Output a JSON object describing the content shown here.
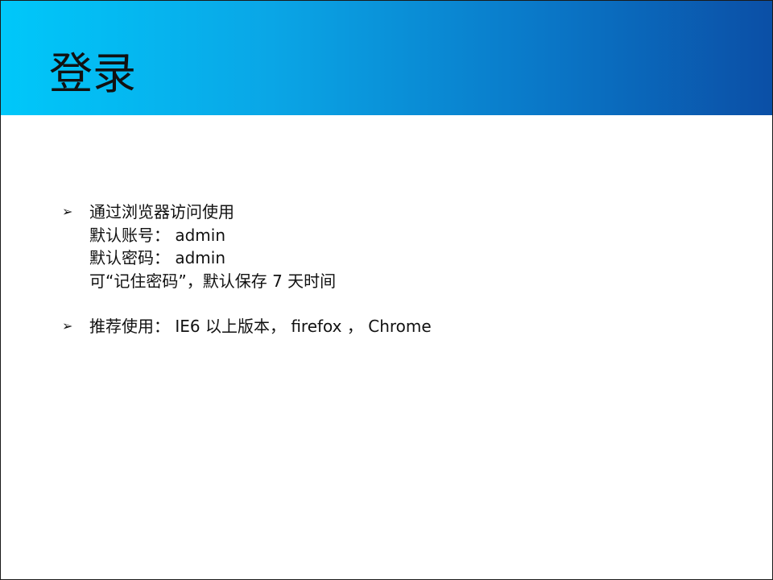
{
  "slide": {
    "title": "登录",
    "colors": {
      "band_left": "#00c8fa",
      "band_right": "#0b4fa6",
      "text": "#111111"
    },
    "bullet_icon": "arrow-bullet-icon",
    "bullet_glyph": "➢",
    "bullets": [
      {
        "lines": [
          "通过浏览器访问使用",
          "默认账号： admin",
          "默认密码： admin",
          "可“记住密码”，默认保存 7 天时间"
        ]
      },
      {
        "lines": [
          "推荐使用： IE6 以上版本， firefox ， Chrome"
        ]
      }
    ]
  }
}
